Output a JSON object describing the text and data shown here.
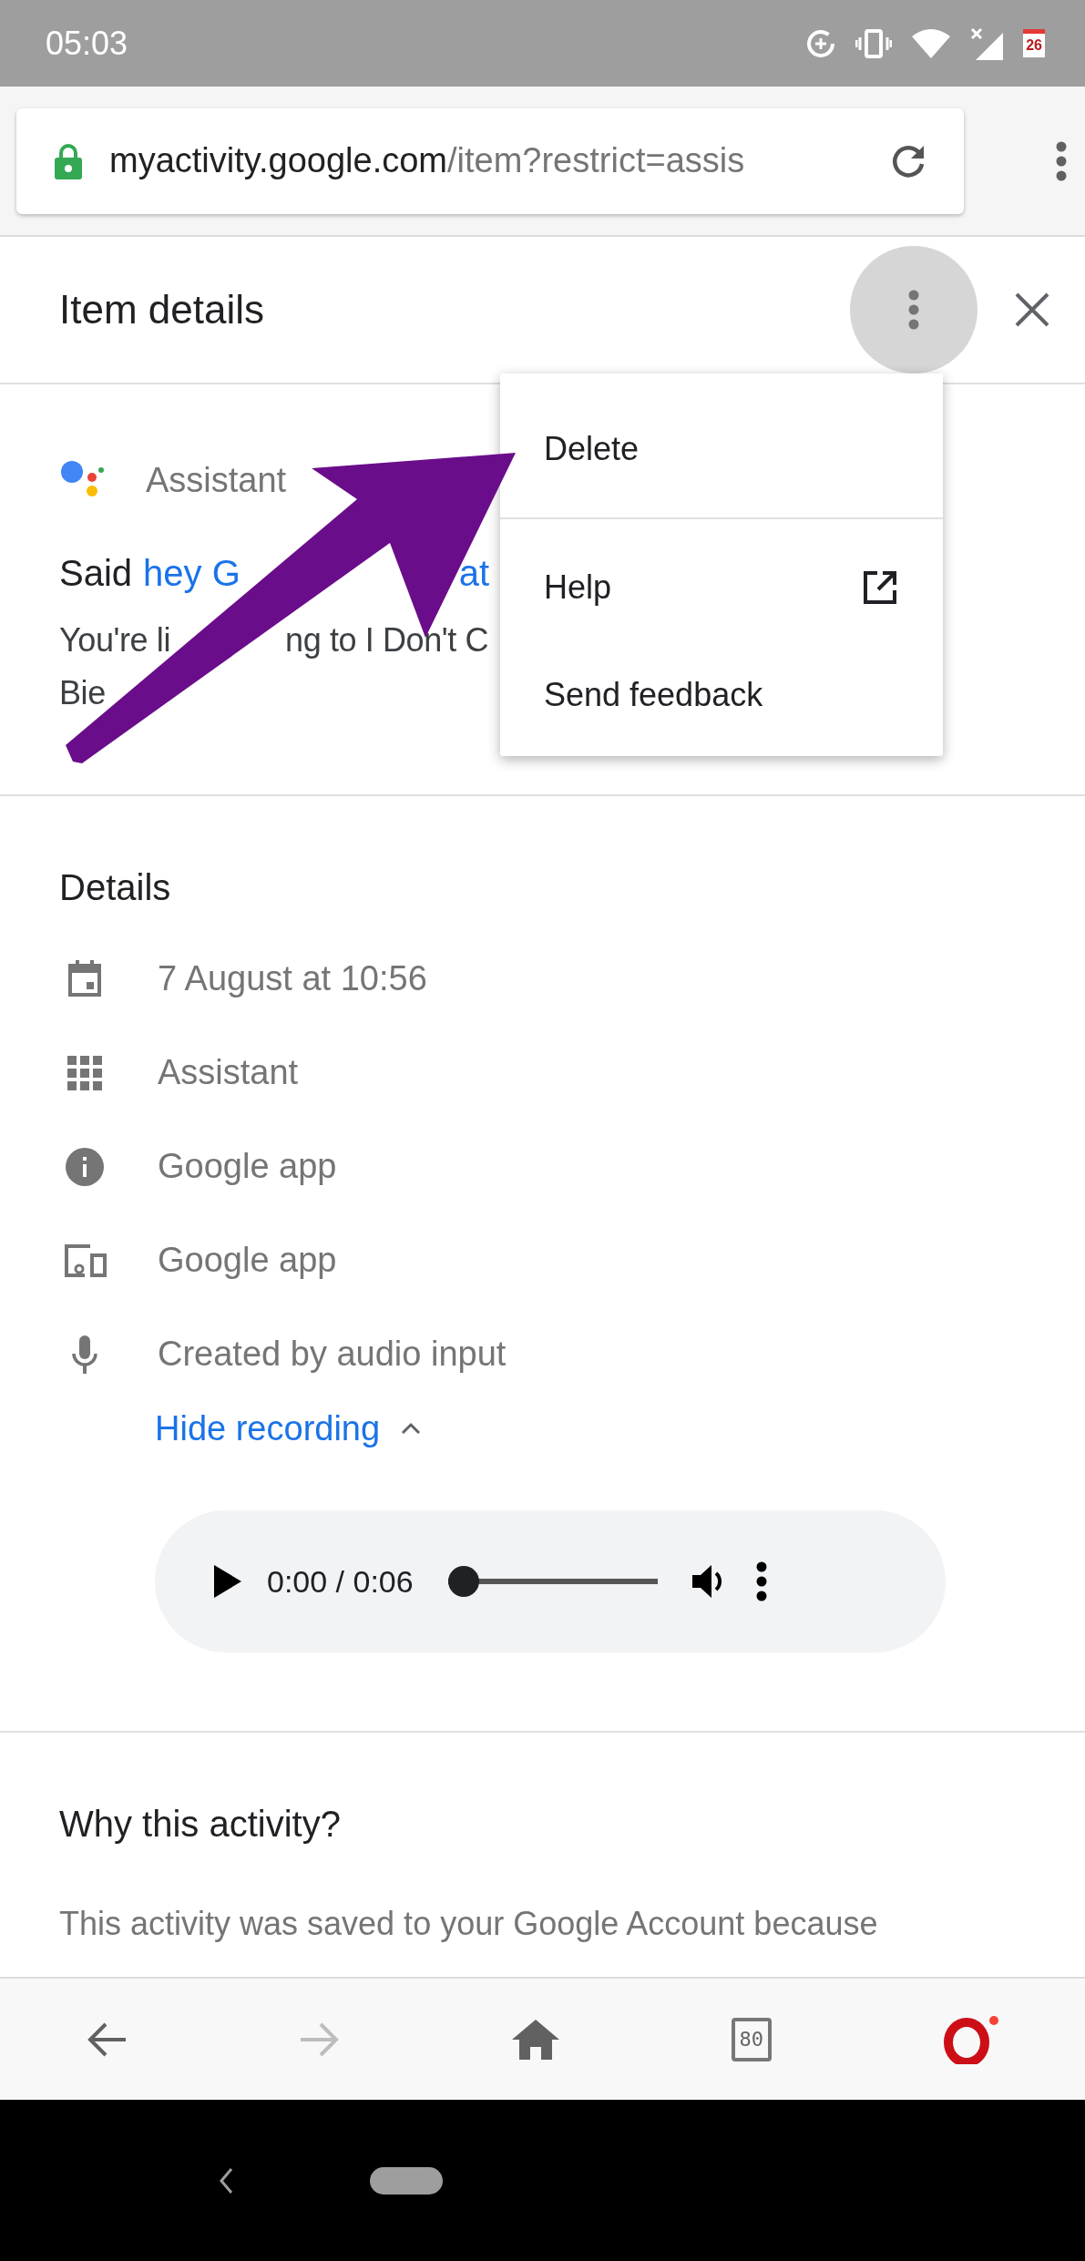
{
  "status_bar": {
    "time": "05:03",
    "calendar_badge": "26"
  },
  "address_bar": {
    "domain": "myactivity.google.com",
    "path": "/item?restrict=assis"
  },
  "header": {
    "title": "Item details",
    "more_pressed": true
  },
  "menu": {
    "groups": [
      [
        {
          "label": "Delete",
          "kind": "plain"
        }
      ],
      [
        {
          "label": "Help",
          "kind": "external"
        },
        {
          "label": "Send feedback",
          "kind": "plain"
        }
      ]
    ]
  },
  "item": {
    "product": "Assistant",
    "query_prefix": "Said",
    "query_link": "hey G",
    "query_tail": "at",
    "response_line_1_start": "You're li",
    "response_line_1_end": "ng to I Don't C",
    "response_line_2": "Bie"
  },
  "details": {
    "title": "Details",
    "rows": [
      {
        "kind": "date",
        "text": "7 August at 10:56"
      },
      {
        "kind": "app",
        "text": "Assistant"
      },
      {
        "kind": "info",
        "text": "Google app"
      },
      {
        "kind": "device",
        "text": "Google app"
      },
      {
        "kind": "mic",
        "text": "Created by audio input"
      }
    ],
    "toggle_link": "Hide recording",
    "expanded": true
  },
  "audio": {
    "time": "0:00 / 0:06",
    "level": 0
  },
  "why": {
    "title": "Why this activity?",
    "text": "This activity was saved to your Google Account because"
  },
  "bottom_bar": {
    "forward_disabled": true,
    "tab_count": "80"
  }
}
